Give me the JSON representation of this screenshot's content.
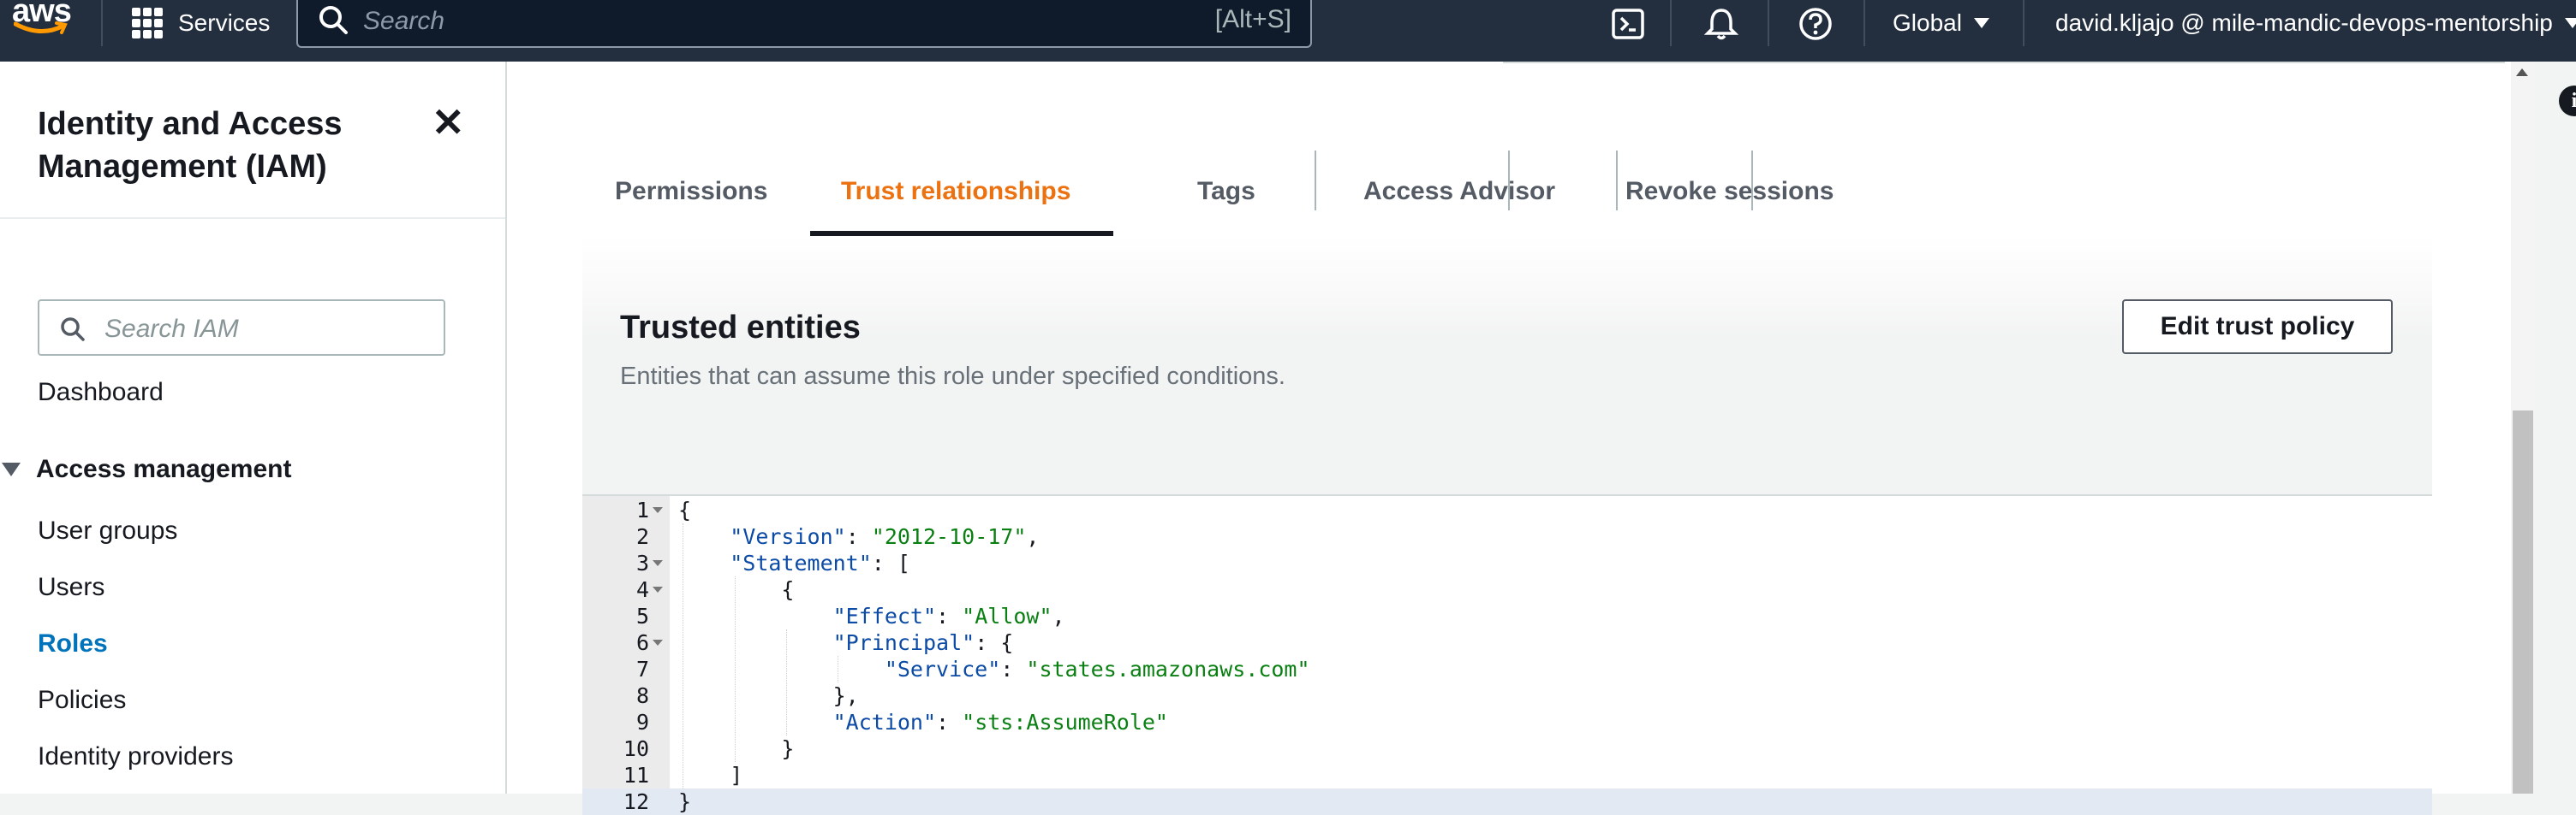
{
  "topnav": {
    "logo": "aws",
    "services_label": "Services",
    "search_placeholder": "Search",
    "search_shortcut": "[Alt+S]",
    "region": "Global",
    "account": "david.kljajo @ mile-mandic-devops-mentorship"
  },
  "sidebar": {
    "title": "Identity and Access Management (IAM)",
    "search_placeholder": "Search IAM",
    "dashboard": "Dashboard",
    "section": "Access management",
    "items": [
      "User groups",
      "Users",
      "Roles",
      "Policies",
      "Identity providers"
    ],
    "active_item": "Roles"
  },
  "tabs": [
    {
      "label": "Permissions"
    },
    {
      "label": "Trust relationships",
      "active": true
    },
    {
      "label": "Tags"
    },
    {
      "label": "Access Advisor"
    },
    {
      "label": "Revoke sessions"
    }
  ],
  "trusted_entities": {
    "title": "Trusted entities",
    "description": "Entities that can assume this role under specified conditions.",
    "edit_button": "Edit trust policy"
  },
  "policy_lines": [
    "{",
    "    \"Version\": \"2012-10-17\",",
    "    \"Statement\": [",
    "        {",
    "            \"Effect\": \"Allow\",",
    "            \"Principal\": {",
    "                \"Service\": \"states.amazonaws.com\"",
    "            },",
    "            \"Action\": \"sts:AssumeRole\"",
    "        }",
    "    ]",
    "}"
  ],
  "foldable_lines": [
    1,
    3,
    4,
    6
  ],
  "highlighted_line": 12,
  "colors": {
    "nav_bg": "#232f3e",
    "accent_orange": "#ec7211",
    "link_blue": "#0073bb",
    "json_key": "#0b4aa5",
    "json_string": "#0a7f12"
  },
  "icons": {
    "services": "grid-icon",
    "search": "search-icon",
    "cloudshell": "cloudshell-icon",
    "notifications": "bell-icon",
    "help": "help-icon",
    "close": "close-icon",
    "info": "info-icon"
  }
}
